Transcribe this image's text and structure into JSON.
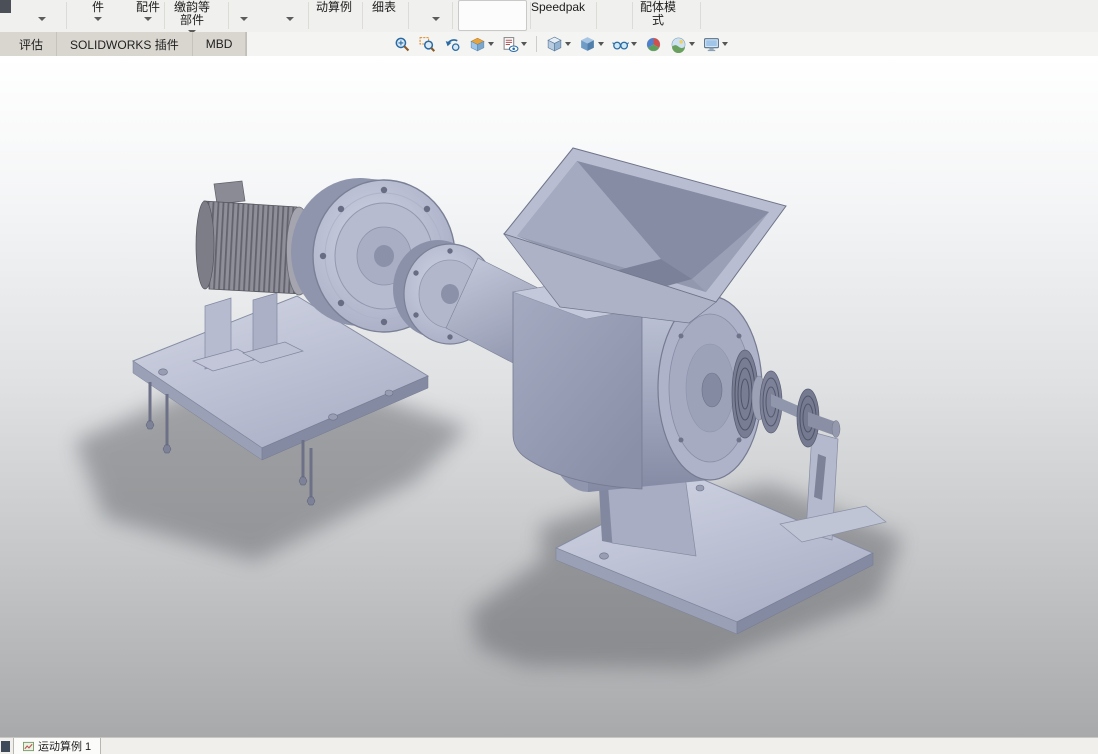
{
  "ribbon": {
    "items": [
      {
        "lines": [
          ""
        ],
        "caret": true
      },
      {
        "lines": [
          "件"
        ],
        "caret": true
      },
      {
        "lines": [
          "配件"
        ],
        "caret": true
      },
      {
        "lines": [
          "缴韵等",
          "部件"
        ],
        "caret": true
      },
      {
        "lines": [
          ""
        ],
        "caret": true
      },
      {
        "lines": [
          ""
        ],
        "caret": true
      },
      {
        "lines": [
          "动算例"
        ],
        "caret": false
      },
      {
        "lines": [
          "细表"
        ],
        "caret": false
      },
      {
        "lines": [
          ""
        ],
        "caret": true
      },
      {
        "lines": [
          "Speedpak"
        ],
        "caret": false
      },
      {
        "lines": [
          "配体模",
          "式"
        ],
        "caret": false
      }
    ]
  },
  "command_tabs": [
    {
      "label": "评估"
    },
    {
      "label": "SOLIDWORKS 插件"
    },
    {
      "label": "MBD"
    }
  ],
  "headsup_toolbar": {
    "icons": [
      {
        "name": "zoom-fit-icon",
        "caret": false
      },
      {
        "name": "zoom-area-icon",
        "caret": false
      },
      {
        "name": "previous-view-icon",
        "caret": false
      },
      {
        "name": "section-view-icon",
        "caret": true
      },
      {
        "name": "annotation-view-icon",
        "caret": true
      },
      {
        "name": "view-orientation-icon",
        "caret": true,
        "group_start": true
      },
      {
        "name": "display-style-icon",
        "caret": true
      },
      {
        "name": "hide-show-items-icon",
        "caret": true
      },
      {
        "name": "edit-appearance-icon",
        "caret": false
      },
      {
        "name": "apply-scene-icon",
        "caret": true
      },
      {
        "name": "view-settings-icon",
        "caret": true
      }
    ]
  },
  "statusbar": {
    "motion_study_tab": "运动算例 1"
  },
  "colors": {
    "model_light": "#c6cadd",
    "model_mid": "#a8aec7",
    "model_dark": "#8b91a9",
    "viewport_top": "#ffffff",
    "viewport_bottom": "#a6a8ab"
  }
}
